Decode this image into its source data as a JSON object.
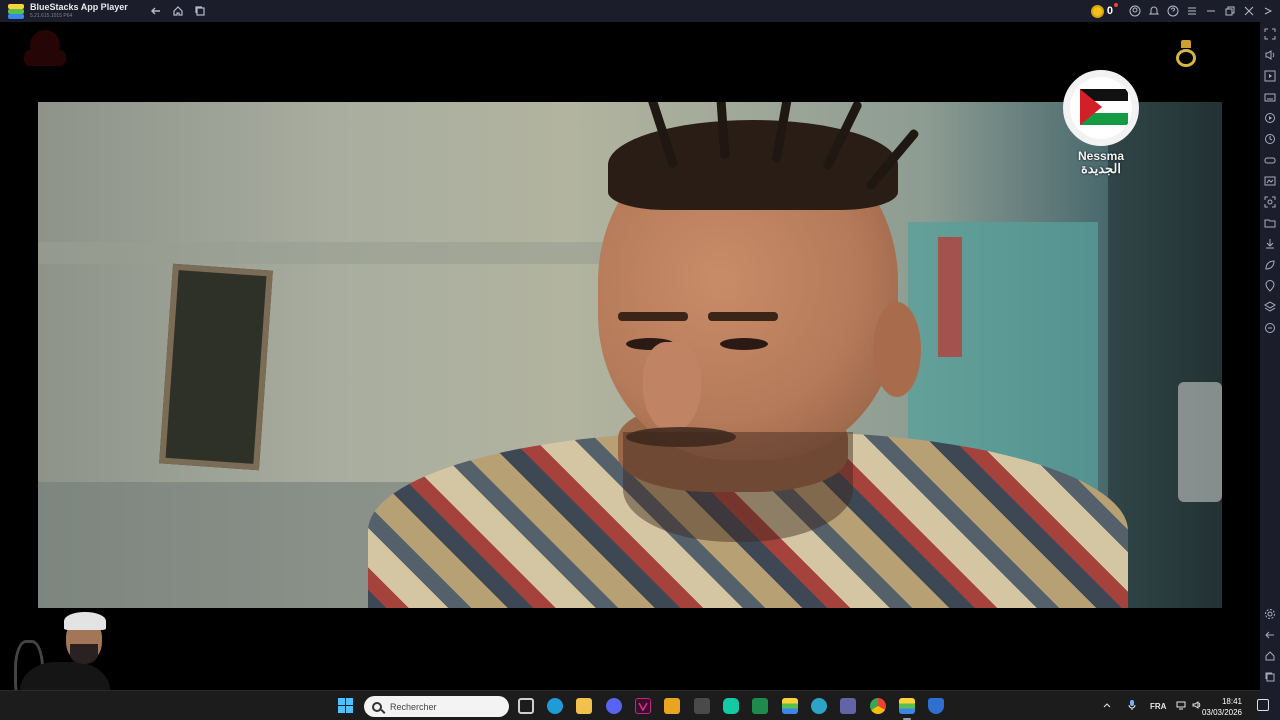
{
  "window": {
    "title": "BlueStacks App Player",
    "version": "5.21.615.1015 P64",
    "coins": "0"
  },
  "video": {
    "channel_logo_latin": "Nessma",
    "channel_logo_arabic": "الجديدة"
  },
  "taskbar": {
    "search_placeholder": "Rechercher",
    "language": "FRA",
    "time": "18:41",
    "date": "03/03/2026",
    "pinned_apps": [
      "task-view",
      "edge",
      "file-explorer",
      "discord",
      "vegas",
      "shield-app",
      "calculator",
      "clipchamp",
      "excel",
      "bluestacks-multi",
      "edge-alt",
      "teams",
      "chrome",
      "bluestacks",
      "defender"
    ]
  },
  "sidebar": {
    "icons": [
      "fullscreen-icon",
      "volume-icon",
      "media-icon",
      "keyboard-icon",
      "record-icon",
      "macro-icon",
      "gamepad-icon",
      "screenshot-icon",
      "capture-icon",
      "folder-icon",
      "install-apk-icon",
      "eco-mode-icon",
      "location-icon",
      "layers-icon",
      "sync-icon",
      "settings-icon",
      "back-icon",
      "home-icon",
      "recent-apps-icon"
    ]
  }
}
